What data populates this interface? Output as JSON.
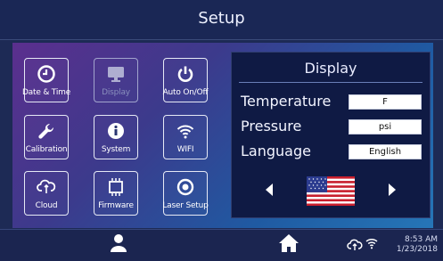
{
  "header": {
    "title": "Setup"
  },
  "tiles": [
    {
      "label": "Date & Time",
      "icon": "clock-icon"
    },
    {
      "label": "Display",
      "icon": "monitor-icon"
    },
    {
      "label": "Auto On/Off",
      "icon": "power-icon"
    },
    {
      "label": "Calibration",
      "icon": "wrench-icon"
    },
    {
      "label": "System",
      "icon": "info-icon"
    },
    {
      "label": "WIFI",
      "icon": "wifi-icon"
    },
    {
      "label": "Cloud",
      "icon": "cloud-sync-icon"
    },
    {
      "label": "Firmware",
      "icon": "chip-icon"
    },
    {
      "label": "Laser Setup",
      "icon": "target-icon"
    }
  ],
  "display_panel": {
    "title": "Display",
    "rows": [
      {
        "label": "Temperature",
        "value": "F"
      },
      {
        "label": "Pressure",
        "value": "psi"
      },
      {
        "label": "Language",
        "value": "English"
      }
    ],
    "flag": "us-flag-icon"
  },
  "footer": {
    "time": "8:53 AM",
    "date": "1/23/2018"
  },
  "colors": {
    "accent_bg": "#1d2a55",
    "tile_border": "#e6e9f5",
    "panel_bg": "#0f1a44"
  }
}
